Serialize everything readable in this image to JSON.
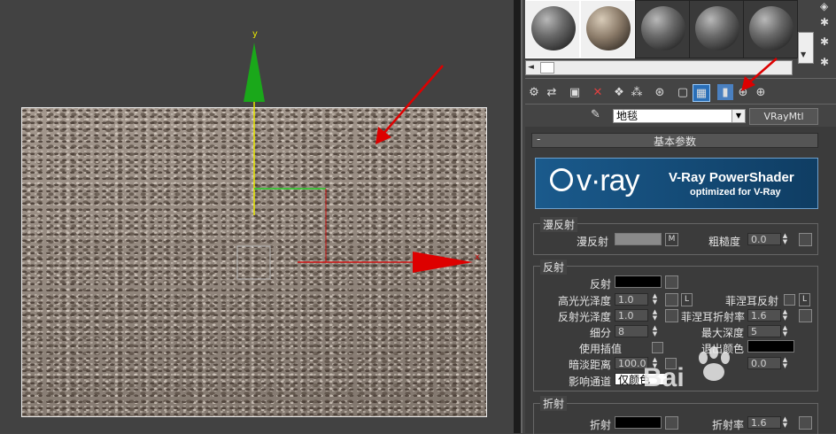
{
  "viewport": {
    "axis_y_label": "y",
    "axis_x_label": "x"
  },
  "material_slots": [
    {
      "name": "slot-1",
      "selected": true
    },
    {
      "name": "slot-2",
      "selected": true
    },
    {
      "name": "slot-3",
      "selected": false
    },
    {
      "name": "slot-4",
      "selected": false
    },
    {
      "name": "slot-5",
      "selected": false
    }
  ],
  "toolbar": {
    "icons": [
      "get-material-icon",
      "put-to-scene-icon",
      "assign-material-icon",
      "delete-icon",
      "make-unique-icon",
      "put-to-library-icon",
      "material-id-icon",
      "show-in-viewport-icon",
      "show-map-icon",
      "checker-icon",
      "end-result-icon",
      "go-to-parent-icon",
      "go-forward-icon"
    ]
  },
  "material": {
    "name": "地毯",
    "type": "VRayMtl"
  },
  "rollout": {
    "collapse_symbol": "-",
    "title": "基本参数"
  },
  "banner": {
    "logo_text": "v·ray",
    "product": "V-Ray PowerShader",
    "subtitle": "optimized for V-Ray",
    "colors": {
      "bg": "#1a5a8c",
      "bg2": "#0f3d63",
      "text": "#ffffff"
    }
  },
  "diffuse": {
    "group_label": "漫反射",
    "diffuse_label": "漫反射",
    "map_button": "M",
    "roughness_label": "粗糙度",
    "roughness_value": "0.0",
    "color": "#8a8a8a"
  },
  "reflection": {
    "group_label": "反射",
    "reflect_label": "反射",
    "reflect_color": "#000000",
    "hilight_gloss_label": "高光光泽度",
    "hilight_gloss_value": "1.0",
    "lock_button": "L",
    "fresnel_label": "菲涅耳反射",
    "fresnel_lock": "L",
    "refl_gloss_label": "反射光泽度",
    "refl_gloss_value": "1.0",
    "fresnel_ior_label": "菲涅耳折射率",
    "fresnel_ior_value": "1.6",
    "subdivs_label": "细分",
    "subdivs_value": "8",
    "max_depth_label": "最大深度",
    "max_depth_value": "5",
    "use_interp_label": "使用插值",
    "exit_color_label": "退出颜色",
    "exit_color": "#000000",
    "dim_distance_label": "暗淡距离",
    "dim_distance_value": "100.0",
    "dim_falloff_value": "0.0",
    "affect_channels_label": "影响通道",
    "affect_channels_value": "仅颜色"
  },
  "refraction": {
    "group_label": "折射",
    "refract_label": "折射",
    "refract_color": "#000000",
    "ior_label": "折射率",
    "ior_value": "1.6"
  },
  "annotation_color": "#dd0000"
}
